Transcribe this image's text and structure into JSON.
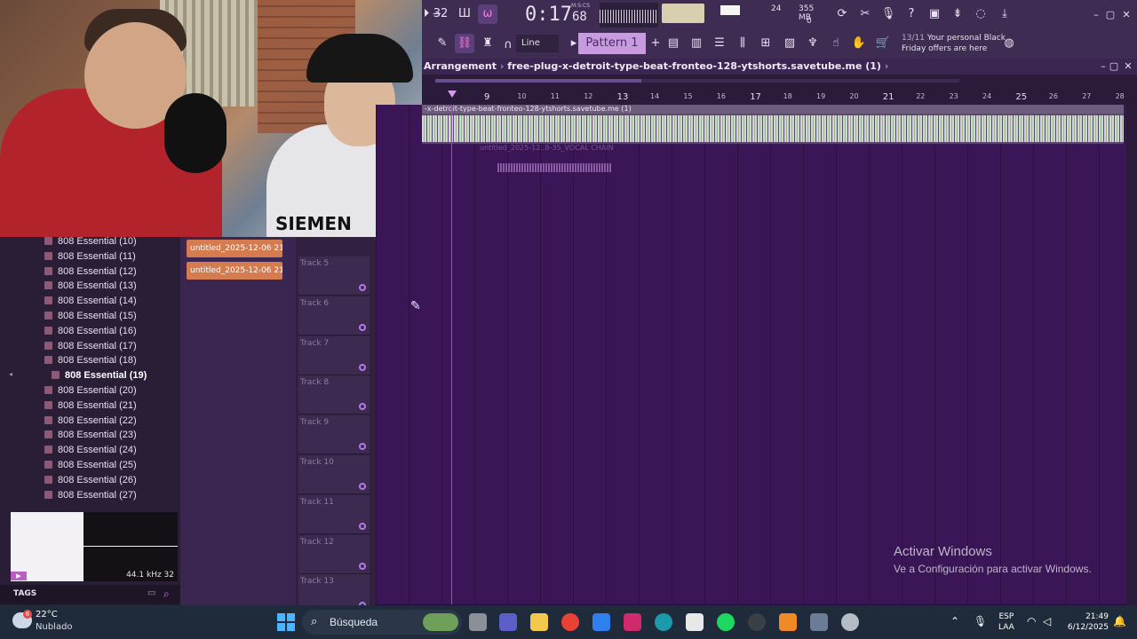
{
  "toolbar": {
    "time": "0:17",
    "time_ms": "68",
    "time_unit": "M:S:CS",
    "cpu": "24",
    "memory": "355 MB",
    "polyphony": "0",
    "snap": "Line",
    "pattern": "Pattern 1",
    "news_count": "13/11",
    "news_text": "Your personal Black Friday offers are here",
    "icons": [
      "pat-song-icon",
      "tempo-icon",
      "metronome-icon",
      "wave-icon"
    ]
  },
  "webcam": {
    "shirt_text": "SIEMEN"
  },
  "playlist": {
    "label": "Arrangement",
    "filename": "free-plug-x-detroit-type-beat-fronteo-128-ytshorts.savetube.me (1)",
    "ruler": [
      "9",
      "10",
      "11",
      "12",
      "13",
      "14",
      "15",
      "16",
      "17",
      "18",
      "19",
      "20",
      "21",
      "22",
      "23",
      "24",
      "25",
      "26",
      "27",
      "28"
    ],
    "audio_clip_title": "-x-detroit-type-beat-fronteo-128-ytshorts.savetube.me (1)",
    "vocal_clip_title": "untitled_2025-12..8-35_VOCAL CHAIN"
  },
  "tracks": [
    {
      "name": "Track 5"
    },
    {
      "name": "Track 6"
    },
    {
      "name": "Track 7"
    },
    {
      "name": "Track 8"
    },
    {
      "name": "Track 9"
    },
    {
      "name": "Track 10"
    },
    {
      "name": "Track 11"
    },
    {
      "name": "Track 12"
    },
    {
      "name": "Track 13"
    }
  ],
  "clips": [
    {
      "label": "untitled_2025-12-06 21-..."
    },
    {
      "label": "untitled_2025-12-06 21-..."
    }
  ],
  "browser": {
    "items": [
      "808 Essential (10)",
      "808 Essential (11)",
      "808 Essential (12)",
      "808 Essential (13)",
      "808 Essential (14)",
      "808 Essential (15)",
      "808 Essential (16)",
      "808 Essential (17)",
      "808 Essential (18)",
      "808 Essential (19)",
      "808 Essential (20)",
      "808 Essential (21)",
      "808 Essential (22)",
      "808 Essential (23)",
      "808 Essential (24)",
      "808 Essential (25)",
      "808 Essential (26)",
      "808 Essential (27)"
    ],
    "selected_index": 9,
    "preview_rate": "44.1 kHz 32",
    "tags_label": "TAGS"
  },
  "watermark": {
    "title": "Activar Windows",
    "subtitle": "Ve a Configuración para activar Windows."
  },
  "taskbar": {
    "weather_temp": "22°C",
    "weather_desc": "Nublado",
    "weather_badge": "6",
    "search_placeholder": "Búsqueda",
    "lang_top": "ESP",
    "lang_bottom": "LAA",
    "time": "21:49",
    "date": "6/12/2025"
  }
}
